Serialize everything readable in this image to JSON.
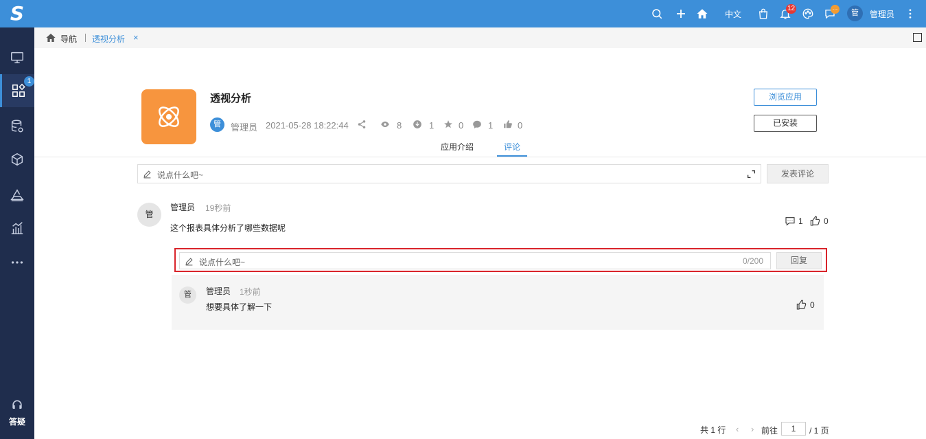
{
  "sidebar": {
    "logo": "S",
    "items": [
      {
        "icon": "monitor-icon"
      },
      {
        "icon": "apps-icon",
        "badge": "1"
      },
      {
        "icon": "database-settings-icon"
      },
      {
        "icon": "cube-icon"
      },
      {
        "icon": "layers-icon"
      },
      {
        "icon": "bar-chart-icon"
      },
      {
        "icon": "more-icon"
      }
    ],
    "help_label": "答疑"
  },
  "topbar": {
    "language": "中文",
    "notification_count": "12",
    "message_badge": "…",
    "avatar_text": "管",
    "username": "管理员"
  },
  "breadcrumb": {
    "home_label": "导航",
    "tab_label": "透视分析",
    "close": "×"
  },
  "app": {
    "title": "透视分析",
    "author_avatar": "管",
    "author": "管理员",
    "date": "2021-05-28 18:22:44",
    "views": "8",
    "downloads": "1",
    "stars": "0",
    "comments": "1",
    "likes": "0",
    "browse_button": "浏览应用",
    "installed_button": "已安装",
    "accent_color": "#f7953e"
  },
  "tabs": [
    {
      "label": "应用介绍",
      "active": false
    },
    {
      "label": "评论",
      "active": true
    }
  ],
  "comment_input": {
    "placeholder": "说点什么吧~",
    "post_button": "发表评论"
  },
  "comment": {
    "avatar": "管",
    "author": "管理员",
    "time": "19秒前",
    "content": "这个报表具体分析了哪些数据呢",
    "reply_count": "1",
    "like_count": "0"
  },
  "reply_input": {
    "placeholder": "说点什么吧~",
    "counter": "0/200",
    "button": "回复"
  },
  "reply": {
    "avatar": "管",
    "author": "管理员",
    "time": "1秒前",
    "content": "想要具体了解一下",
    "like_count": "0"
  },
  "pagination": {
    "total": "共 1 行",
    "prev": "‹",
    "next": "›",
    "goto_label": "前往",
    "page": "1",
    "total_pages": "/ 1 页"
  }
}
